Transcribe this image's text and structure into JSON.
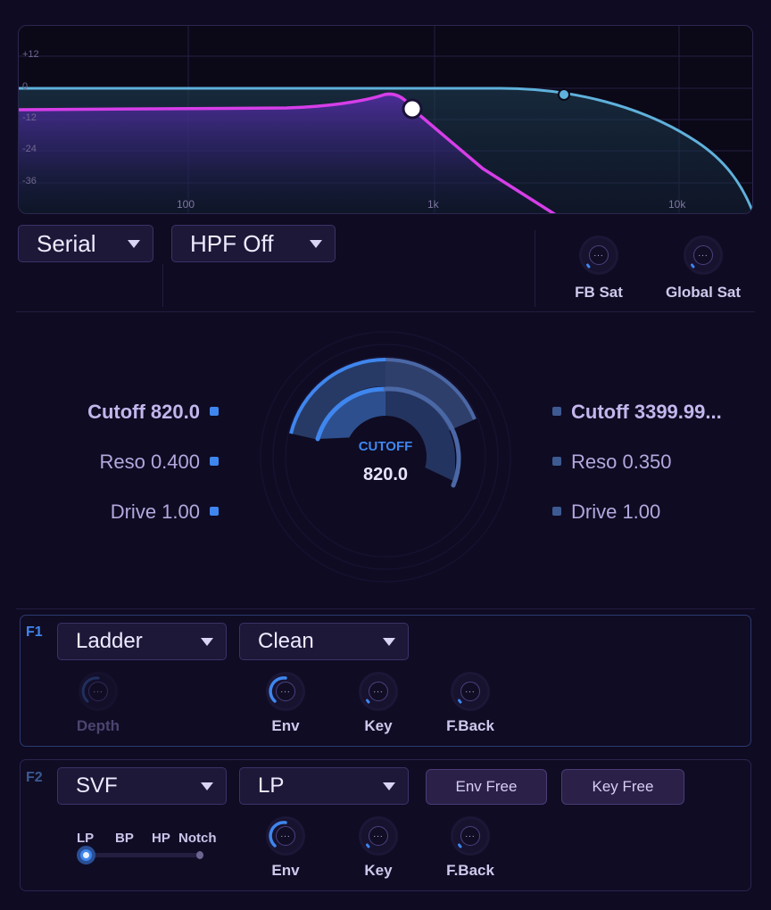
{
  "graph": {
    "db_ticks": [
      "+12",
      "0",
      "-12",
      "-24",
      "-36"
    ],
    "freq_ticks": [
      "100",
      "1k",
      "10k"
    ],
    "colors": {
      "primary_curve": "#d63ee8",
      "secondary_curve": "#5fb1db",
      "grid": "#2c2650"
    }
  },
  "routing": {
    "mode": "Serial",
    "hpf": "HPF Off"
  },
  "saturation": {
    "fb_sat_label": "FB Sat",
    "global_sat_label": "Global Sat",
    "knob_value": "..."
  },
  "filter1_params": {
    "cutoff": "Cutoff 820.0",
    "reso": "Reso 0.400",
    "drive": "Drive 1.00"
  },
  "filter2_params": {
    "cutoff": "Cutoff 3399.99...",
    "reso": "Reso 0.350",
    "drive": "Drive 1.00"
  },
  "center_dial": {
    "label": "CUTOFF",
    "value": "820.0"
  },
  "f1": {
    "tag": "F1",
    "type": "Ladder",
    "character": "Clean",
    "knobs": {
      "depth": "Depth",
      "env": "Env",
      "key": "Key",
      "feedback": "F.Back"
    }
  },
  "f2": {
    "tag": "F2",
    "type": "SVF",
    "mode": "LP",
    "env_free": "Env Free",
    "key_free": "Key Free",
    "morph_modes": [
      "LP",
      "BP",
      "HP",
      "Notch"
    ],
    "knobs": {
      "env": "Env",
      "key": "Key",
      "feedback": "F.Back"
    }
  },
  "accent": {
    "blue": "#3f86ee",
    "blue_dim": "#3a5a93",
    "purple": "#d63ee8"
  }
}
